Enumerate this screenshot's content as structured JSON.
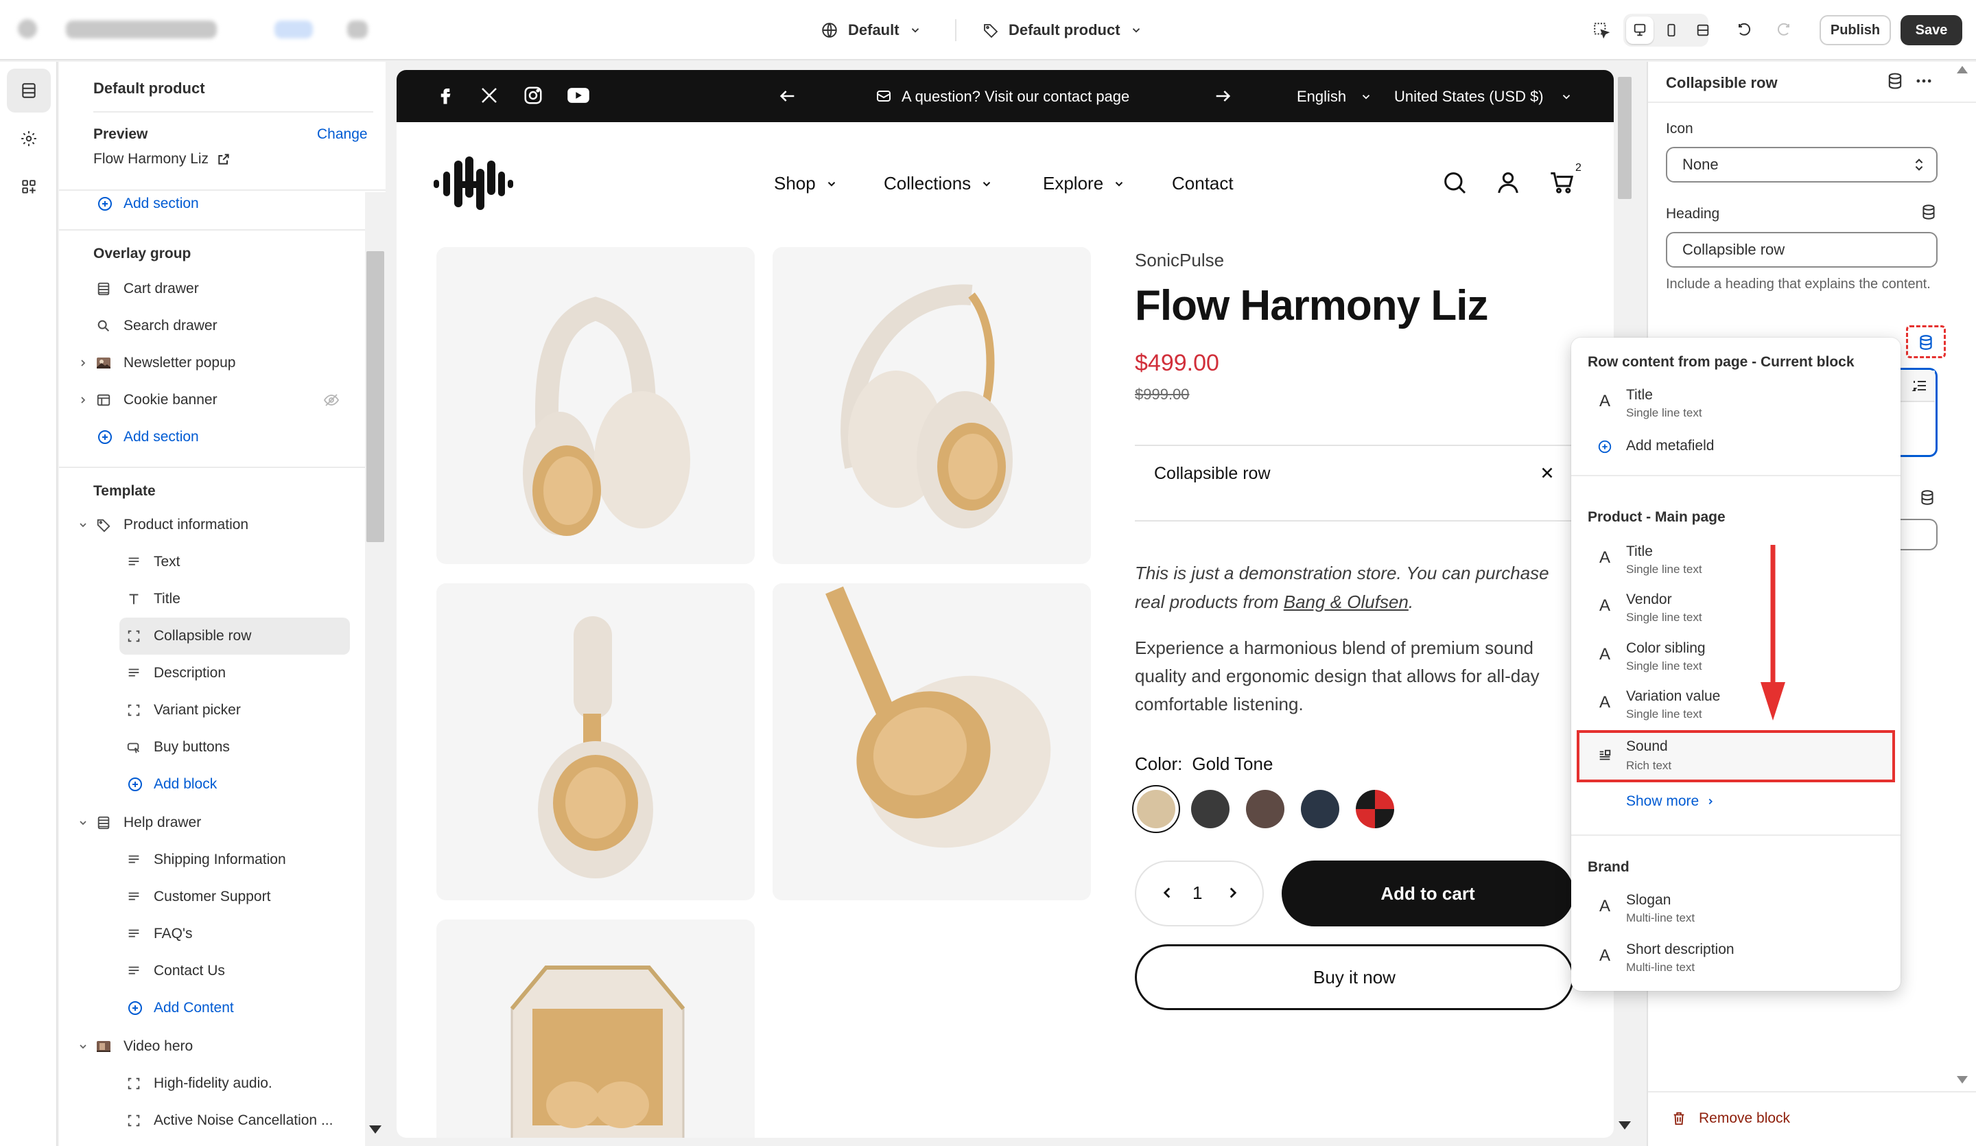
{
  "topbar": {
    "theme_selector": "Default",
    "template_selector": "Default product",
    "publish_label": "Publish",
    "save_label": "Save"
  },
  "left_panel": {
    "title": "Default product",
    "preview_label": "Preview",
    "preview_change": "Change",
    "preview_product": "Flow Harmony Liz",
    "add_section_1": "Add section",
    "overlay_group_title": "Overlay group",
    "overlay_items": [
      {
        "label": "Cart drawer",
        "icon": "cart-drawer-icon"
      },
      {
        "label": "Search drawer",
        "icon": "search-icon"
      },
      {
        "label": "Newsletter popup",
        "icon": "newsletter-image-icon"
      },
      {
        "label": "Cookie banner",
        "icon": "banner-icon"
      }
    ],
    "add_section_2": "Add section",
    "template_title": "Template",
    "product_information": "Product information",
    "product_blocks": [
      "Text",
      "Title",
      "Collapsible row",
      "Description",
      "Variant picker",
      "Buy buttons"
    ],
    "add_block": "Add block",
    "help_drawer": "Help drawer",
    "help_blocks": [
      "Shipping Information",
      "Customer Support",
      "FAQ's",
      "Contact Us"
    ],
    "add_content": "Add Content",
    "video_hero": "Video hero",
    "video_blocks": [
      "High-fidelity audio.",
      "Active Noise Cancellation ..."
    ]
  },
  "preview": {
    "announcement": "A question? Visit our contact page",
    "language": "English",
    "currency": "United States (USD $)",
    "nav": [
      "Shop",
      "Collections",
      "Explore",
      "Contact"
    ],
    "cart_count": "2",
    "vendor": "SonicPulse",
    "product_title": "Flow Harmony Liz",
    "price": "$499.00",
    "compare_price": "$999.00",
    "collapsible_row": "Collapsible row",
    "demo_text_1": "This is just a demonstration store. You can purchase",
    "demo_text_2": "real products from ",
    "demo_link": "Bang & Olufsen",
    "demo_text_3": ".",
    "description": "Experience a harmonious blend of premium sound quality and ergonomic design that allows for all-day comfortable listening.",
    "color_label": "Color:",
    "color_value": "Gold Tone",
    "swatches": [
      "#d8c3a0",
      "#3a3a3a",
      "#5e4a44",
      "#2a3646",
      "#d92b2b"
    ],
    "quantity": "1",
    "add_to_cart": "Add to cart",
    "buy_now": "Buy it now"
  },
  "right_panel": {
    "title": "Collapsible row",
    "icon_label": "Icon",
    "icon_value": "None",
    "heading_label": "Heading",
    "heading_value": "Collapsible row",
    "heading_help": "Include a heading that explains the content.",
    "remove_block": "Remove block"
  },
  "popover": {
    "section1_title": "Row content from page - Current block",
    "section1_items": [
      {
        "name": "Title",
        "type": "Single line text"
      }
    ],
    "add_metafield": "Add metafield",
    "section2_title": "Product - Main page",
    "section2_items": [
      {
        "name": "Title",
        "type": "Single line text"
      },
      {
        "name": "Vendor",
        "type": "Single line text"
      },
      {
        "name": "Color sibling",
        "type": "Single line text"
      },
      {
        "name": "Variation value",
        "type": "Single line text"
      },
      {
        "name": "Sound",
        "type": "Rich text"
      }
    ],
    "show_more": "Show more",
    "section3_title": "Brand",
    "section3_items": [
      {
        "name": "Slogan",
        "type": "Multi-line text"
      },
      {
        "name": "Short description",
        "type": "Multi-line text"
      }
    ],
    "highlight_color": "#e5312f"
  }
}
